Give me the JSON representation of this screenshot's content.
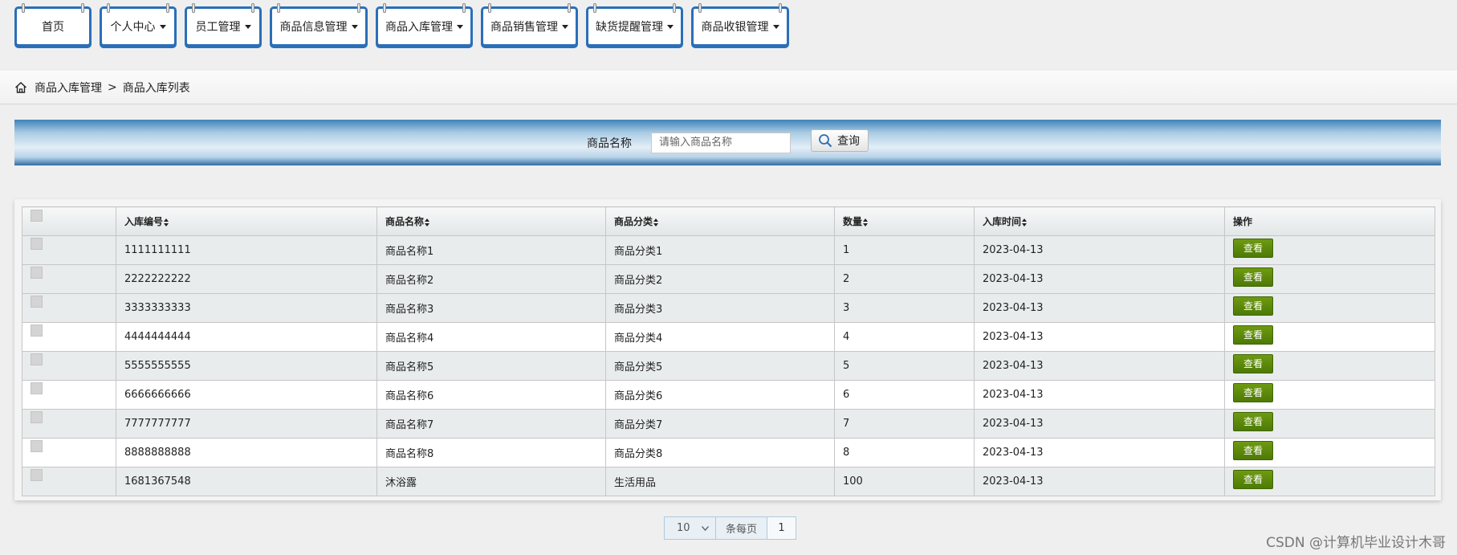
{
  "nav": [
    {
      "label": "首页",
      "dropdown": false
    },
    {
      "label": "个人中心",
      "dropdown": true
    },
    {
      "label": "员工管理",
      "dropdown": true
    },
    {
      "label": "商品信息管理",
      "dropdown": true
    },
    {
      "label": "商品入库管理",
      "dropdown": true
    },
    {
      "label": "商品销售管理",
      "dropdown": true
    },
    {
      "label": "缺货提醒管理",
      "dropdown": true
    },
    {
      "label": "商品收银管理",
      "dropdown": true
    }
  ],
  "breadcrumb": {
    "section": "商品入库管理",
    "separator": ">",
    "page": "商品入库列表"
  },
  "search": {
    "label": "商品名称",
    "placeholder": "请输入商品名称",
    "button": "查询"
  },
  "table": {
    "columns": {
      "id": "入库编号",
      "name": "商品名称",
      "category": "商品分类",
      "qty": "数量",
      "time": "入库时间",
      "ops": "操作"
    },
    "rows": [
      {
        "id": "1111111111",
        "name": "商品名称1",
        "category": "商品分类1",
        "qty": "1",
        "time": "2023-04-13",
        "action": "查看"
      },
      {
        "id": "2222222222",
        "name": "商品名称2",
        "category": "商品分类2",
        "qty": "2",
        "time": "2023-04-13",
        "action": "查看"
      },
      {
        "id": "3333333333",
        "name": "商品名称3",
        "category": "商品分类3",
        "qty": "3",
        "time": "2023-04-13",
        "action": "查看"
      },
      {
        "id": "4444444444",
        "name": "商品名称4",
        "category": "商品分类4",
        "qty": "4",
        "time": "2023-04-13",
        "action": "查看"
      },
      {
        "id": "5555555555",
        "name": "商品名称5",
        "category": "商品分类5",
        "qty": "5",
        "time": "2023-04-13",
        "action": "查看"
      },
      {
        "id": "6666666666",
        "name": "商品名称6",
        "category": "商品分类6",
        "qty": "6",
        "time": "2023-04-13",
        "action": "查看"
      },
      {
        "id": "7777777777",
        "name": "商品名称7",
        "category": "商品分类7",
        "qty": "7",
        "time": "2023-04-13",
        "action": "查看"
      },
      {
        "id": "8888888888",
        "name": "商品名称8",
        "category": "商品分类8",
        "qty": "8",
        "time": "2023-04-13",
        "action": "查看"
      },
      {
        "id": "1681367548",
        "name": "沐浴露",
        "category": "生活用品",
        "qty": "100",
        "time": "2023-04-13",
        "action": "查看"
      }
    ]
  },
  "pagination": {
    "page_size": "10",
    "per_page_label": "条每页",
    "current_page": "1"
  },
  "watermark": "CSDN @计算机毕业设计木哥",
  "colors": {
    "nav_border": "#2a6fb8",
    "search_bar": "#3f82b9",
    "view_button": "#5b8a0b"
  }
}
